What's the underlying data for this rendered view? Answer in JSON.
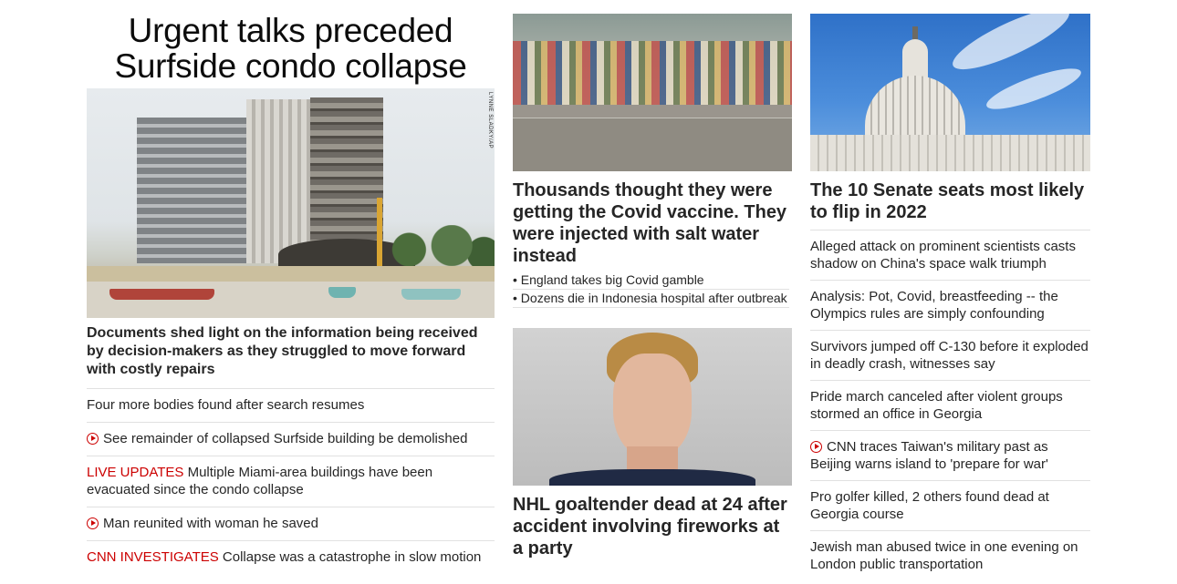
{
  "col1": {
    "headline": "Urgent talks preceded Surfside condo collapse",
    "photo_credit": "LYNNE SLADKY/AP",
    "lead": "Documents shed light on the information being received by decision-makers as they struggled to move forward with costly repairs",
    "items": [
      {
        "kicker": "",
        "video": false,
        "text": "Four more bodies found after search resumes"
      },
      {
        "kicker": "",
        "video": true,
        "text": "See remainder of collapsed Surfside building be demolished"
      },
      {
        "kicker": "LIVE UPDATES",
        "video": false,
        "text": "Multiple Miami-area buildings have been evacuated since the condo collapse"
      },
      {
        "kicker": "",
        "video": true,
        "text": "Man reunited with woman he saved"
      },
      {
        "kicker": "CNN INVESTIGATES",
        "video": false,
        "text": "Collapse was a catastrophe in slow motion"
      }
    ]
  },
  "col2": {
    "story1": {
      "headline": "Thousands thought they were getting the Covid vaccine. They were injected with salt water instead",
      "bullets": [
        "England takes big Covid gamble",
        "Dozens die in Indonesia hospital after outbreak"
      ]
    },
    "story2": {
      "headline": "NHL goaltender dead at 24 after accident involving fireworks at a party"
    }
  },
  "col3": {
    "headline": "The 10 Senate seats most likely to flip in 2022",
    "items": [
      {
        "video": false,
        "text": "Alleged attack on prominent scientists casts shadow on China's space walk triumph"
      },
      {
        "video": false,
        "text": "Analysis: Pot, Covid, breastfeeding -- the Olympics rules are simply confounding"
      },
      {
        "video": false,
        "text": "Survivors jumped off C-130 before it exploded in deadly crash, witnesses say"
      },
      {
        "video": false,
        "text": "Pride march canceled after violent groups stormed an office in Georgia"
      },
      {
        "video": true,
        "text": "CNN traces Taiwan's military past as Beijing warns island to 'prepare for war'"
      },
      {
        "video": false,
        "text": "Pro golfer killed, 2 others found dead at Georgia course"
      },
      {
        "video": false,
        "text": "Jewish man abused twice in one evening on London public transportation"
      }
    ]
  },
  "colors": {
    "accent_red": "#cc0000",
    "text": "#262626",
    "divider": "#e1e1e1"
  },
  "icons": {
    "video": "play-circle-icon"
  }
}
